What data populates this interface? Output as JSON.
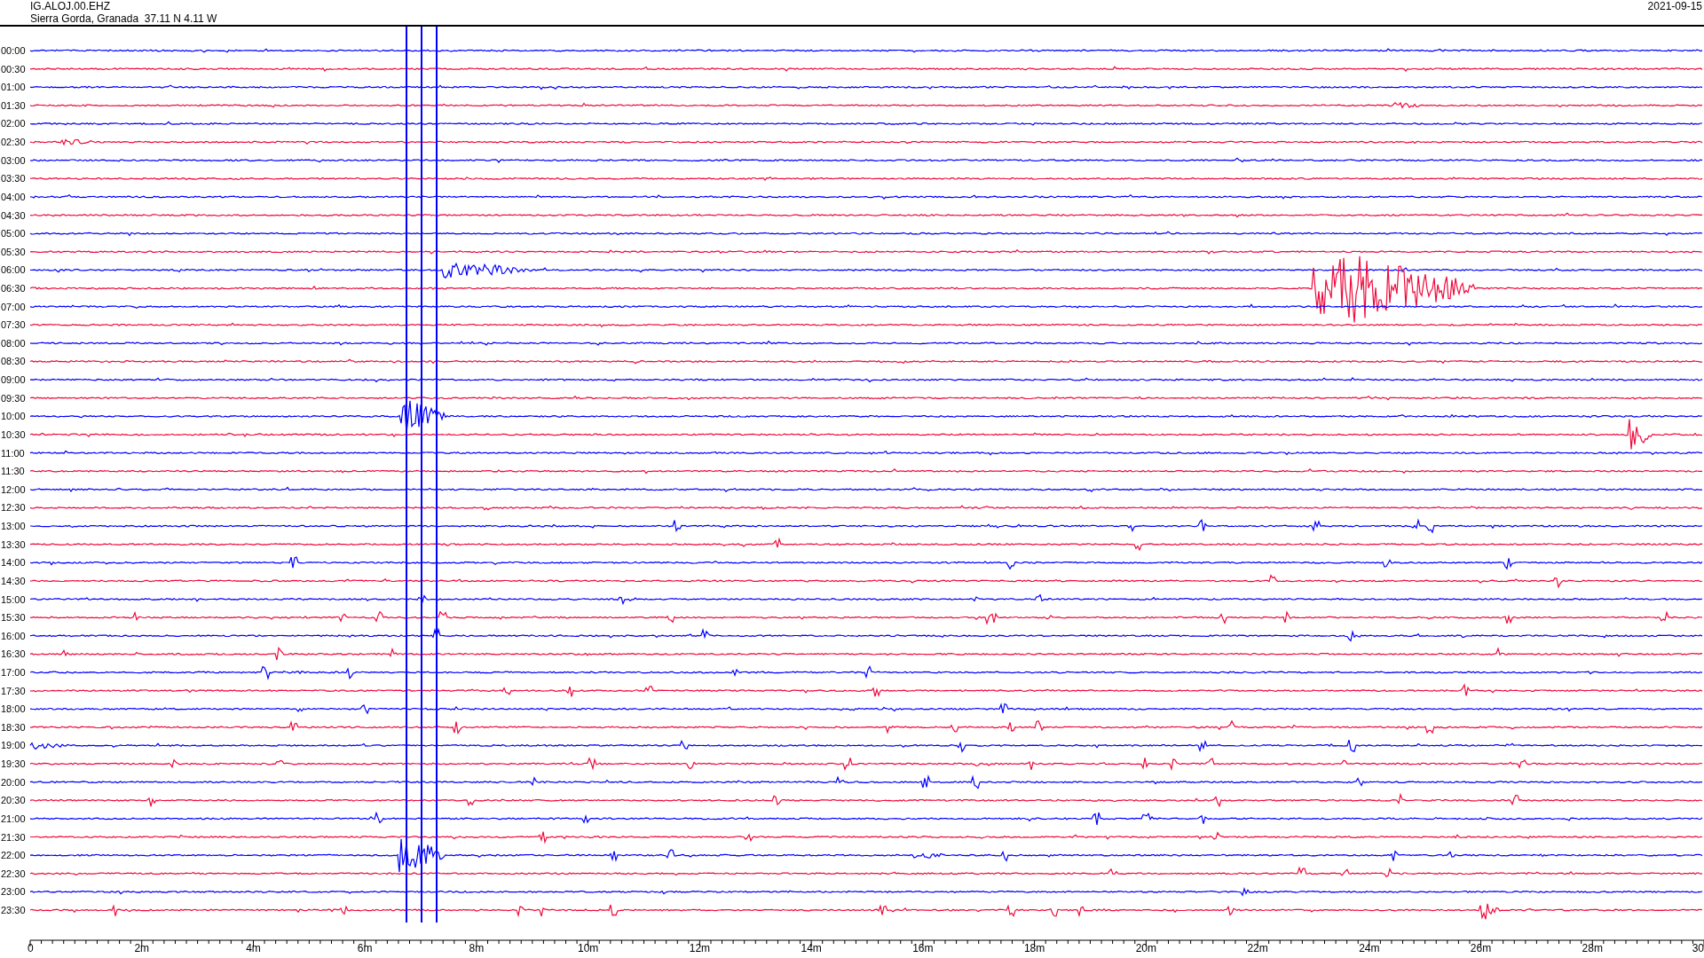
{
  "header": {
    "station": "IG.ALOJ.00.EHZ",
    "location": "Sierra Gorda, Granada  37.11 N 4.11 W",
    "date": "2021-09-15"
  },
  "traces": [
    {
      "label": "00:00",
      "color": "#0000ff"
    },
    {
      "label": "00:30",
      "color": "#f00a3c"
    },
    {
      "label": "01:00",
      "color": "#0000ff"
    },
    {
      "label": "01:30",
      "color": "#f00a3c"
    },
    {
      "label": "02:00",
      "color": "#0000ff"
    },
    {
      "label": "02:30",
      "color": "#f00a3c"
    },
    {
      "label": "03:00",
      "color": "#0000ff"
    },
    {
      "label": "03:30",
      "color": "#f00a3c"
    },
    {
      "label": "04:00",
      "color": "#0000ff"
    },
    {
      "label": "04:30",
      "color": "#f00a3c"
    },
    {
      "label": "05:00",
      "color": "#0000ff"
    },
    {
      "label": "05:30",
      "color": "#f00a3c"
    },
    {
      "label": "06:00",
      "color": "#0000ff"
    },
    {
      "label": "06:30",
      "color": "#f00a3c"
    },
    {
      "label": "07:00",
      "color": "#0000ff"
    },
    {
      "label": "07:30",
      "color": "#f00a3c"
    },
    {
      "label": "08:00",
      "color": "#0000ff"
    },
    {
      "label": "08:30",
      "color": "#f00a3c"
    },
    {
      "label": "09:00",
      "color": "#0000ff"
    },
    {
      "label": "09:30",
      "color": "#f00a3c"
    },
    {
      "label": "10:00",
      "color": "#0000ff"
    },
    {
      "label": "10:30",
      "color": "#f00a3c"
    },
    {
      "label": "11:00",
      "color": "#0000ff"
    },
    {
      "label": "11:30",
      "color": "#f00a3c"
    },
    {
      "label": "12:00",
      "color": "#0000ff"
    },
    {
      "label": "12:30",
      "color": "#f00a3c"
    },
    {
      "label": "13:00",
      "color": "#0000ff"
    },
    {
      "label": "13:30",
      "color": "#f00a3c"
    },
    {
      "label": "14:00",
      "color": "#0000ff"
    },
    {
      "label": "14:30",
      "color": "#f00a3c"
    },
    {
      "label": "15:00",
      "color": "#0000ff"
    },
    {
      "label": "15:30",
      "color": "#f00a3c"
    },
    {
      "label": "16:00",
      "color": "#0000ff"
    },
    {
      "label": "16:30",
      "color": "#f00a3c"
    },
    {
      "label": "17:00",
      "color": "#0000ff"
    },
    {
      "label": "17:30",
      "color": "#f00a3c"
    },
    {
      "label": "18:00",
      "color": "#0000ff"
    },
    {
      "label": "18:30",
      "color": "#f00a3c"
    },
    {
      "label": "19:00",
      "color": "#0000ff"
    },
    {
      "label": "19:30",
      "color": "#f00a3c"
    },
    {
      "label": "20:00",
      "color": "#0000ff"
    },
    {
      "label": "20:30",
      "color": "#f00a3c"
    },
    {
      "label": "21:00",
      "color": "#0000ff"
    },
    {
      "label": "21:30",
      "color": "#f00a3c"
    },
    {
      "label": "22:00",
      "color": "#0000ff"
    },
    {
      "label": "22:30",
      "color": "#f00a3c"
    },
    {
      "label": "23:00",
      "color": "#0000ff"
    },
    {
      "label": "23:30",
      "color": "#f00a3c"
    }
  ],
  "x_axis_labels": [
    "0",
    "2m",
    "4m",
    "6m",
    "8m",
    "10m",
    "12m",
    "14m",
    "16m",
    "18m",
    "20m",
    "22m",
    "24m",
    "26m",
    "28m",
    "30"
  ]
}
